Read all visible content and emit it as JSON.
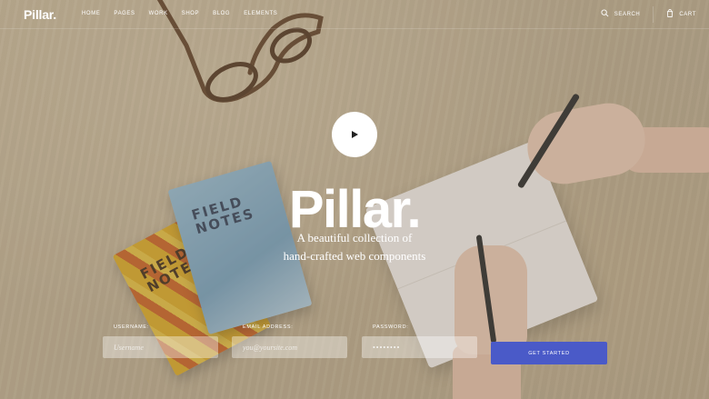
{
  "brand": {
    "logo": "Pillar."
  },
  "nav": {
    "items": [
      "HOME",
      "PAGES",
      "WORK",
      "SHOP",
      "BLOG",
      "ELEMENTS"
    ],
    "search_label": "SEARCH",
    "search_icon": "search-icon",
    "cart_label": "CART",
    "cart_icon": "cart-icon"
  },
  "hero": {
    "play_icon": "play-icon",
    "title": "Pillar.",
    "subtitle_line1": "A beautiful collection of",
    "subtitle_line2": "hand-crafted web components"
  },
  "photo": {
    "book_text_1": "FIELD NOTES",
    "book_text_2": "FIELD NOTES"
  },
  "form": {
    "username_label": "USERNAME:",
    "username_placeholder": "Username",
    "email_label": "EMAIL ADDRESS:",
    "email_placeholder": "you@yoursite.com",
    "password_label": "PASSWORD:",
    "password_value": "••••••••",
    "submit_label": "GET STARTED"
  },
  "colors": {
    "accent": "#4a5ac8",
    "text": "#ffffff"
  }
}
